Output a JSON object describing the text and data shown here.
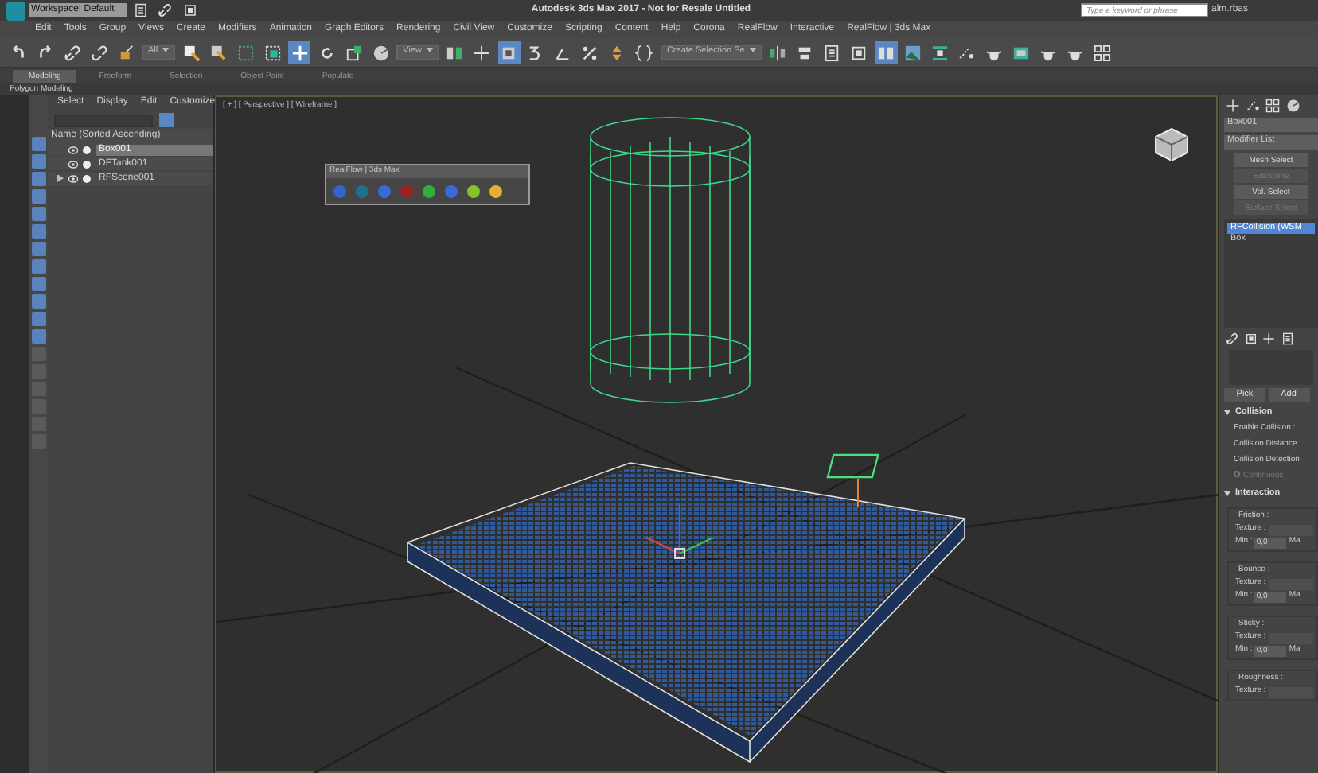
{
  "title_bar": {
    "workspace": "Workspace: Default",
    "title": "Autodesk 3ds Max 2017 - Not for Resale   Untitled",
    "search": {
      "placeholder": "Type a keyword or phrase"
    },
    "user": "alm.rbas"
  },
  "menu_bar": [
    "Edit",
    "Tools",
    "Group",
    "Views",
    "Create",
    "Modifiers",
    "Animation",
    "Graph Editors",
    "Rendering",
    "Civil View",
    "Customize",
    "Scripting",
    "Content",
    "Help",
    "Corona",
    "RealFlow",
    "Interactive",
    "RealFlow | 3ds Max"
  ],
  "toolbar": [
    {
      "kind": "undo",
      "selected": false
    },
    {
      "kind": "redo",
      "selected": false
    },
    {
      "kind": "link",
      "selected": false
    },
    {
      "kind": "unlink",
      "selected": false
    },
    {
      "kind": "bind",
      "selected": false
    },
    {
      "kind": "dropdown",
      "value": "All",
      "selected": false
    },
    {
      "kind": "select",
      "selected": false
    },
    {
      "kind": "select-list",
      "selected": false
    },
    {
      "kind": "region",
      "selected": false
    },
    {
      "kind": "window",
      "selected": false
    },
    {
      "kind": "move",
      "selected": true
    },
    {
      "kind": "rotate",
      "selected": false
    },
    {
      "kind": "scale",
      "selected": false
    },
    {
      "kind": "sphere",
      "selected": false
    },
    {
      "kind": "dropdown",
      "value": "View",
      "selected": false
    },
    {
      "kind": "pivot",
      "selected": false
    },
    {
      "kind": "cross",
      "selected": false
    },
    {
      "kind": "frame",
      "selected": true
    },
    {
      "kind": "snap",
      "selected": false
    },
    {
      "kind": "angle",
      "selected": false
    },
    {
      "kind": "percent",
      "selected": false
    },
    {
      "kind": "spinner",
      "selected": false
    },
    {
      "kind": "braces",
      "selected": false
    },
    {
      "kind": "dropdown",
      "value": "Create Selection Se",
      "selected": false
    },
    {
      "kind": "mirror",
      "selected": false
    },
    {
      "kind": "align",
      "selected": false
    },
    {
      "kind": "list",
      "selected": false
    },
    {
      "kind": "panel",
      "selected": false
    },
    {
      "kind": "panes",
      "selected": true
    },
    {
      "kind": "image",
      "selected": false
    },
    {
      "kind": "bar",
      "selected": false
    },
    {
      "kind": "curve",
      "selected": false
    },
    {
      "kind": "teapot",
      "selected": false
    },
    {
      "kind": "picture",
      "selected": false
    },
    {
      "kind": "teapot",
      "selected": false
    },
    {
      "kind": "teapot",
      "selected": false
    },
    {
      "kind": "grid",
      "selected": false
    }
  ],
  "ribbon": {
    "tabs": [
      {
        "label": "Modeling",
        "selected": true
      },
      {
        "label": "Freeform",
        "selected": false
      },
      {
        "label": "Selection",
        "selected": false
      },
      {
        "label": "Object Paint",
        "selected": false
      },
      {
        "label": "Populate",
        "selected": false
      }
    ],
    "panel": "Polygon Modeling"
  },
  "scene_explorer": {
    "menu": [
      "Select",
      "Display",
      "Edit",
      "Customize"
    ],
    "column": "Name (Sorted Ascending)",
    "items": [
      {
        "name": "Box001",
        "selected": true
      },
      {
        "name": "DFTank001",
        "selected": false
      },
      {
        "name": "RFScene001",
        "selected": false,
        "expanded": false
      }
    ]
  },
  "viewport": {
    "label": "[ + ] [ Perspective ] [ Wireframe ]",
    "floater": {
      "title": "RealFlow | 3ds Max"
    }
  },
  "command_panel": {
    "object_name": "Box001",
    "modifier_list": "Modifier List",
    "modifier_buttons": [
      {
        "label": "Mesh Select",
        "disabled": false
      },
      {
        "label": "EditSpline",
        "disabled": true
      },
      {
        "label": "Vol. Select",
        "disabled": false
      },
      {
        "label": "Surface Select",
        "disabled": true
      }
    ],
    "stack": [
      {
        "label": "RFCollision (WSM",
        "selected": true
      },
      {
        "label": "Box",
        "selected": false
      }
    ],
    "pick_buttons": [
      "Pick",
      "Add"
    ],
    "rollouts": [
      {
        "title": "Collision",
        "expanded": true,
        "rows": [
          {
            "kind": "label",
            "text": "Enable Collision :"
          },
          {
            "kind": "label",
            "text": "Collision Distance :"
          },
          {
            "kind": "label",
            "text": "Collision Detection"
          },
          {
            "kind": "radio",
            "text": "Continuous",
            "disabled": true
          }
        ]
      },
      {
        "title": "Interaction",
        "expanded": true,
        "groups": [
          {
            "label": "Friction :",
            "texture": "Texture :",
            "min": "Min :",
            "value": "0,0",
            "max": "Ma"
          },
          {
            "label": "Bounce :",
            "texture": "Texture :",
            "min": "Min :",
            "value": "0,0",
            "max": "Ma"
          },
          {
            "label": "Sticky :",
            "texture": "Texture :",
            "min": "Min :",
            "value": "0,0",
            "max": "Ma"
          },
          {
            "label": "Roughness :",
            "texture": "Texture :"
          }
        ]
      }
    ]
  }
}
